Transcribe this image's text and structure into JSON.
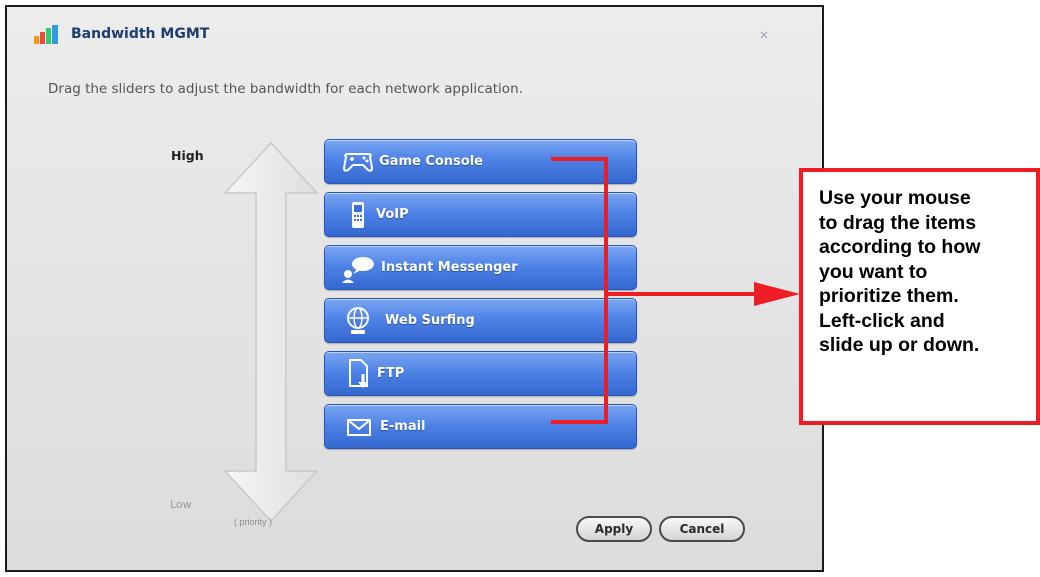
{
  "dialog": {
    "title": "Bandwidth MGMT",
    "close_symbol": "×",
    "instruction": "Drag the sliders to adjust the bandwidth for each network application."
  },
  "priority_scale": {
    "high_label": "High",
    "low_label": "Low",
    "priority_label": "( priority )"
  },
  "applications": [
    {
      "label": "Game Console",
      "icon": "gamepad-icon"
    },
    {
      "label": "VoIP",
      "icon": "phone-icon"
    },
    {
      "label": "Instant Messenger",
      "icon": "chat-bubble-icon"
    },
    {
      "label": "Web Surfing",
      "icon": "globe-icon"
    },
    {
      "label": "FTP",
      "icon": "file-download-icon"
    },
    {
      "label": "E-mail",
      "icon": "envelope-icon"
    }
  ],
  "buttons": {
    "apply": "Apply",
    "cancel": "Cancel"
  },
  "annotation": {
    "text": "Use your mouse\nto drag the items\naccording to how\nyou want to\nprioritize them.\nLeft-click and\nslide up or down."
  },
  "colors": {
    "accent_blue": "#4f83e6",
    "callout_red": "#ee1c25",
    "title_blue": "#1f3c6e"
  }
}
